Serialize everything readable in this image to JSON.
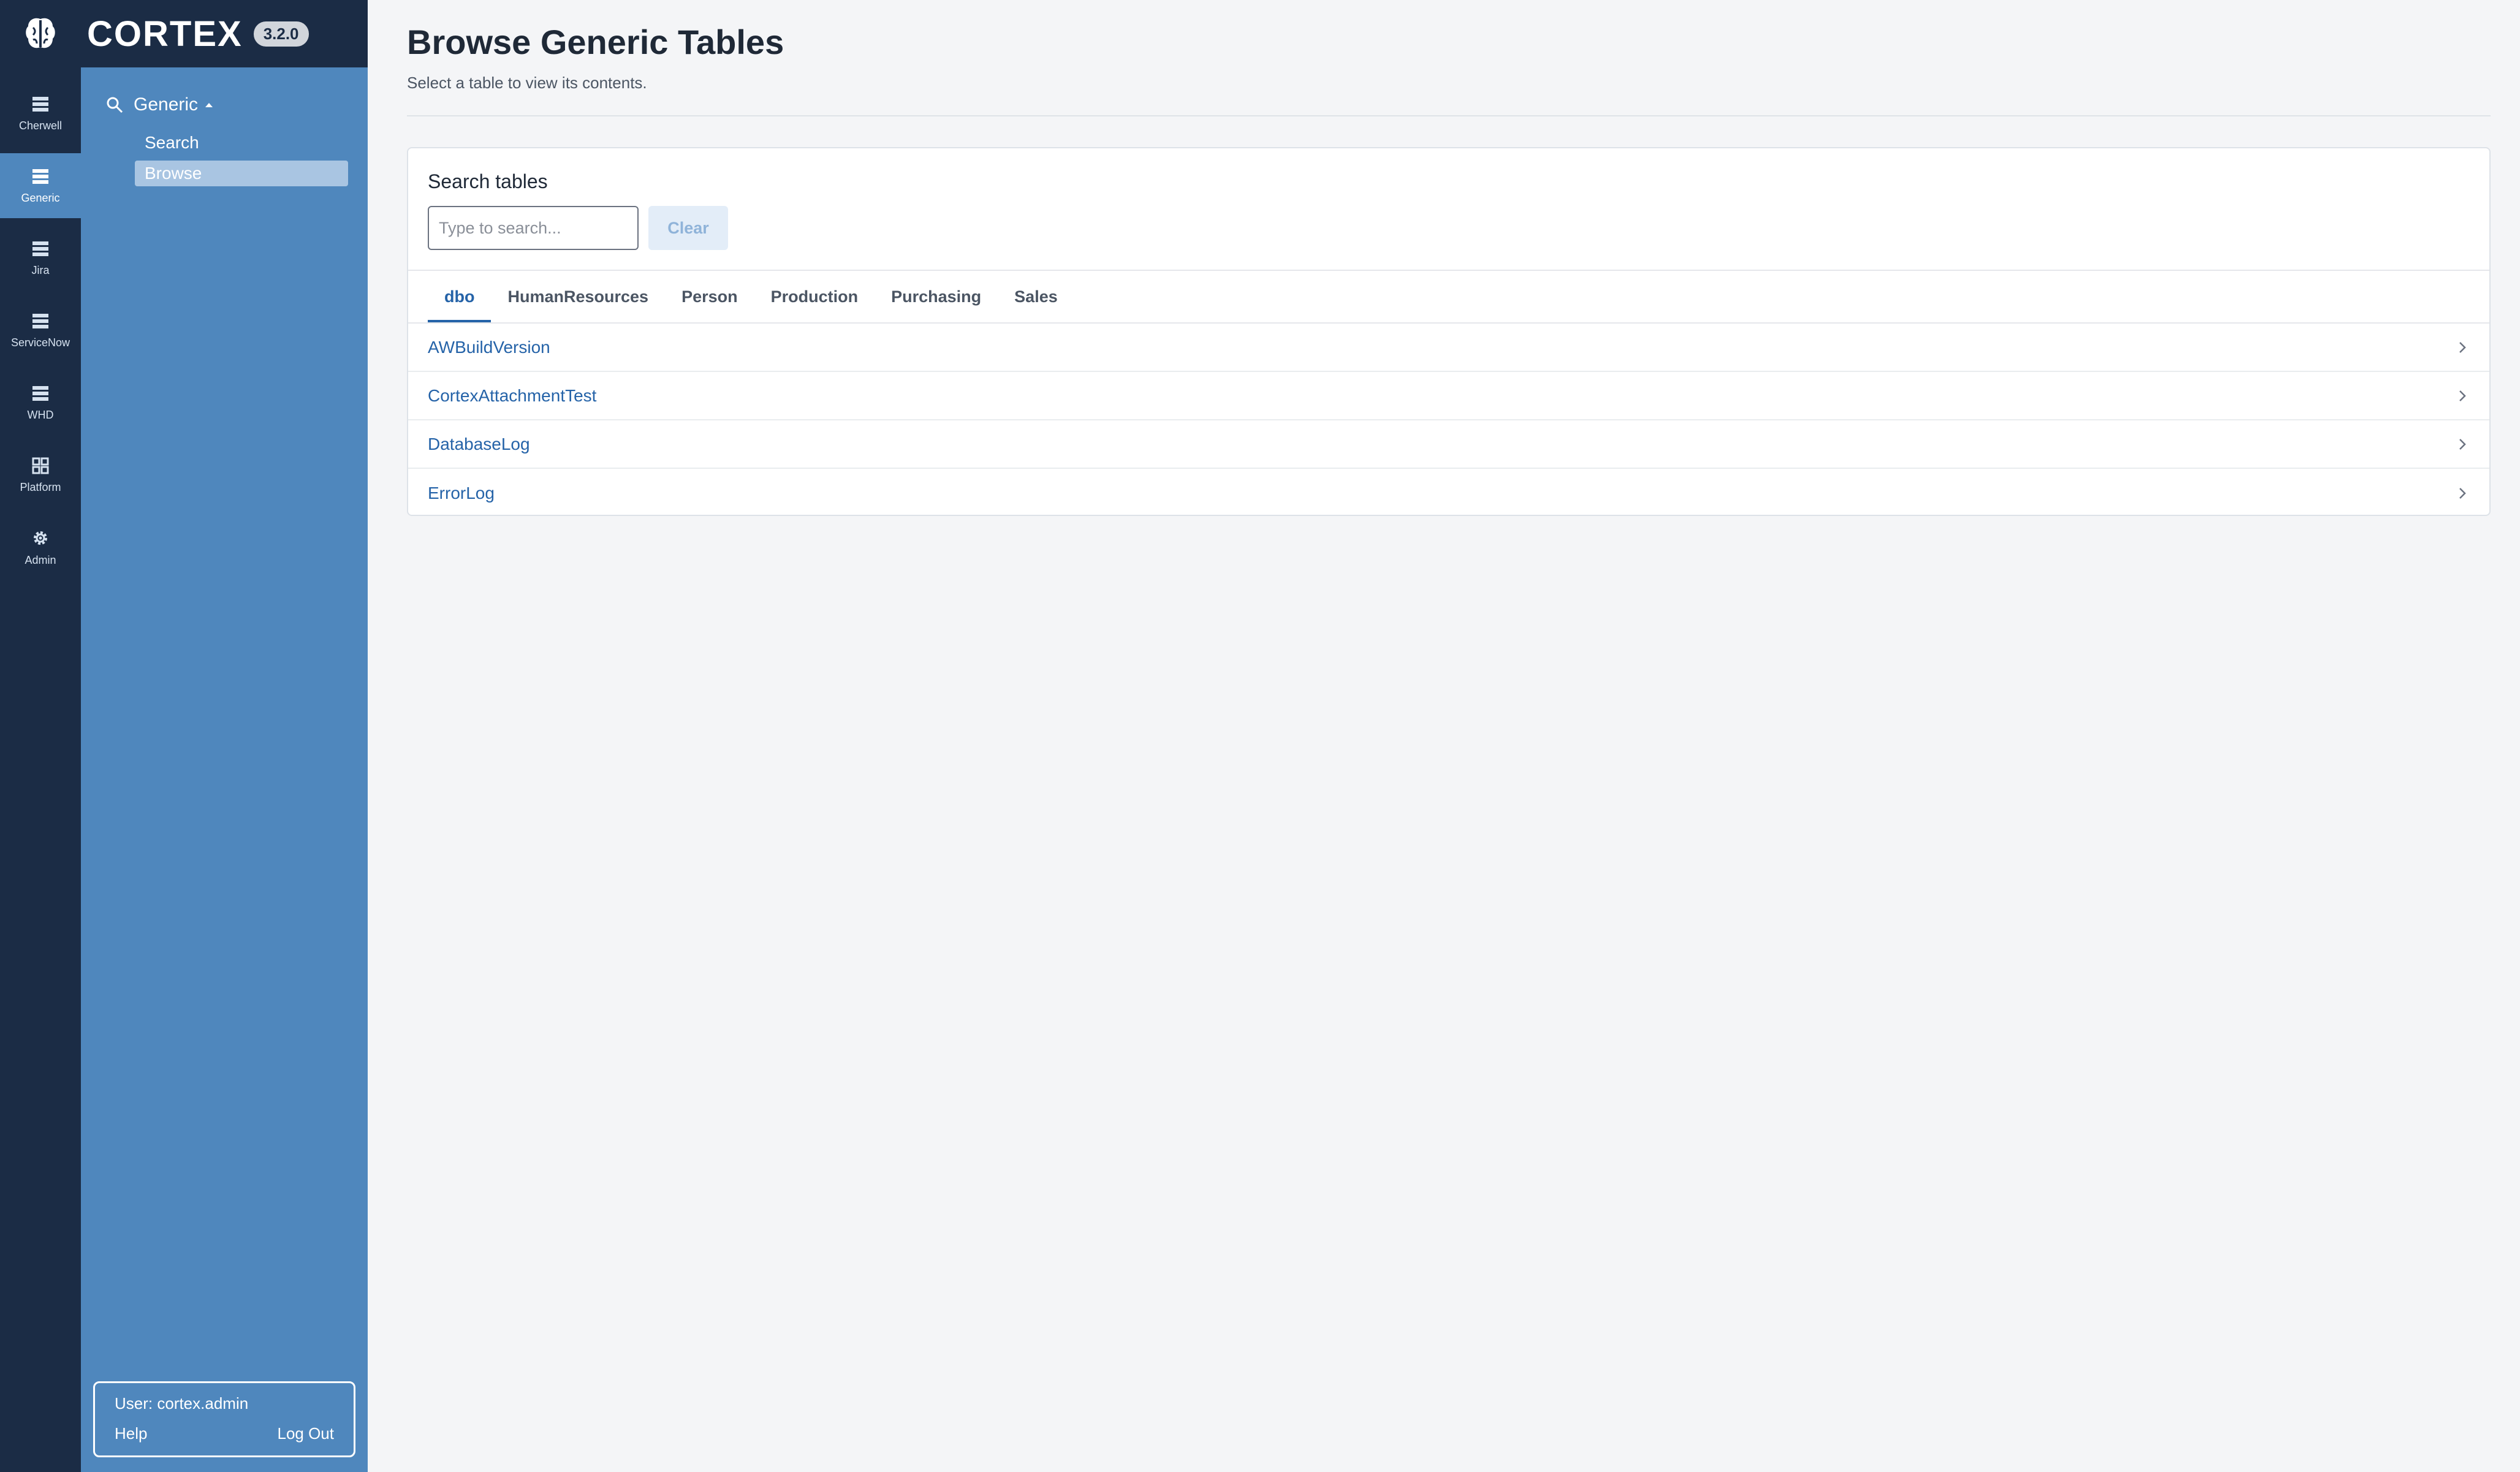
{
  "app": {
    "name": "CORTEX",
    "version": "3.2.0"
  },
  "rail": {
    "items": [
      {
        "label": "Cherwell",
        "icon": "list-icon"
      },
      {
        "label": "Generic",
        "icon": "list-icon",
        "active": true
      },
      {
        "label": "Jira",
        "icon": "list-icon"
      },
      {
        "label": "ServiceNow",
        "icon": "list-icon"
      },
      {
        "label": "WHD",
        "icon": "list-icon"
      },
      {
        "label": "Platform",
        "icon": "grid-icon"
      },
      {
        "label": "Admin",
        "icon": "gear-icon"
      }
    ]
  },
  "subnav": {
    "group": "Generic",
    "items": [
      {
        "label": "Search"
      },
      {
        "label": "Browse",
        "active": true
      }
    ]
  },
  "user": {
    "text": "User: cortex.admin",
    "help": "Help",
    "logout": "Log Out"
  },
  "page": {
    "title": "Browse Generic Tables",
    "subtitle": "Select a table to view its contents."
  },
  "search": {
    "label": "Search tables",
    "placeholder": "Type to search...",
    "clear": "Clear"
  },
  "tabs": [
    {
      "label": "dbo",
      "active": true
    },
    {
      "label": "HumanResources"
    },
    {
      "label": "Person"
    },
    {
      "label": "Production"
    },
    {
      "label": "Purchasing"
    },
    {
      "label": "Sales"
    }
  ],
  "tables": [
    {
      "name": "AWBuildVersion"
    },
    {
      "name": "CortexAttachmentTest"
    },
    {
      "name": "DatabaseLog"
    },
    {
      "name": "ErrorLog"
    }
  ],
  "colors": {
    "rail": "#1b2c45",
    "sidebar": "#4f87bd",
    "accent": "#2563a8"
  }
}
